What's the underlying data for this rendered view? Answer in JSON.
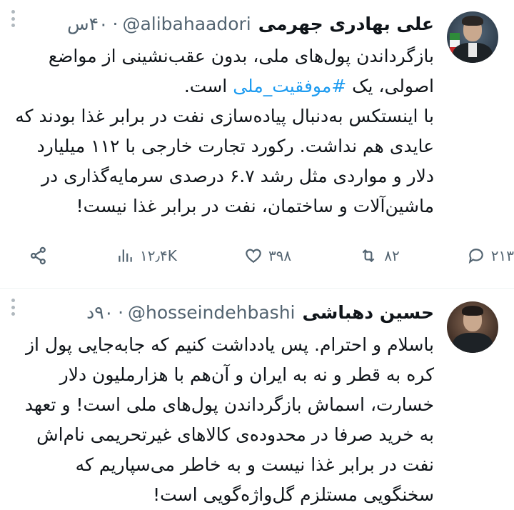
{
  "tweets": [
    {
      "author_name": "علی بهادری جهرمی",
      "handle": "@alibahaadori",
      "separator": "·",
      "time": "۴۰س",
      "text_before_hashtag": "بازگرداندن پول‌های ملی، بدون عقب‌نشینی از مواضع اصولی، یک ",
      "hashtag": "#موفقیت_ملی",
      "text_after_hashtag": " است.\nبا اینستکس به‌دنبال پیاده‌سازی نفت در برابر غذا بودند که عایدی هم نداشت. رکورد تجارت خارجی با ۱۱۲ میلیارد دلار و مواردی مثل رشد ۶.۷ درصدی سرمایه‌گذاری در ماشین‌آلات و ساختمان، نفت در برابر غذا نیست!",
      "actions": {
        "replies": "۲۱۳",
        "retweets": "۸۲",
        "likes": "۳۹۸",
        "views": "۱۲٫۴K"
      },
      "icons": [
        "reply-icon",
        "retweet-icon",
        "like-icon",
        "views-icon",
        "share-icon",
        "more-icon"
      ]
    },
    {
      "author_name": "حسین دهباشی",
      "handle": "@hosseindehbashi",
      "separator": "·",
      "time": "۹۰د",
      "text": "باسلام و احترام. پس یادداشت کنیم که جابه‌جایی پول از کره به قطر و نه به ایران و آن‌هم با هزارملیون دلار خسارت، اسماش بازگرداندن پول‌های ملی است! و تعهد به خرید صرفا در محدوده‌ی کالاهای غیرتحریمی نام‌اش نفت در برابر غذا نیست و به خاطر می‌سپاریم که سخنگویی مستلزم گل‌واژه‌گویی است!"
    }
  ],
  "colors": {
    "accent": "#1d9bf0",
    "muted": "#536471",
    "text": "#0f1419"
  }
}
